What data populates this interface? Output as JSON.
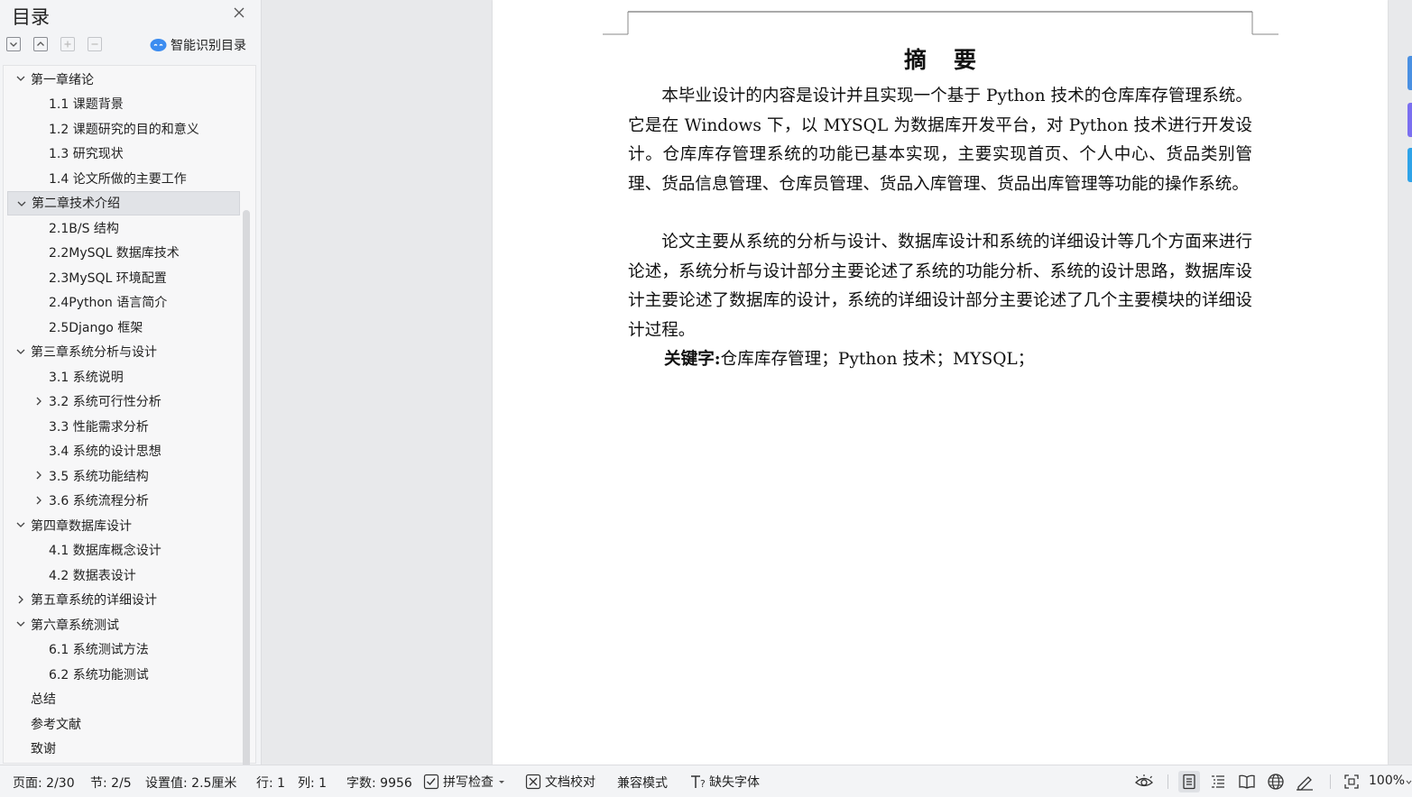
{
  "sidebar": {
    "title": "目录",
    "smart_toc_label": "智能识别目录",
    "toc_items": [
      {
        "label": "第一章绪论",
        "level": 1,
        "caret": "expanded"
      },
      {
        "label": "1.1 课题背景",
        "level": 2,
        "caret": "none"
      },
      {
        "label": "1.2 课题研究的目的和意义",
        "level": 2,
        "caret": "none"
      },
      {
        "label": "1.3  研究现状",
        "level": 2,
        "caret": "none"
      },
      {
        "label": "1.4 论文所做的主要工作",
        "level": 2,
        "caret": "none"
      },
      {
        "label": "第二章技术介绍",
        "level": 1,
        "caret": "expanded",
        "selected": true
      },
      {
        "label": "2.1B/S 结构",
        "level": 2,
        "caret": "none"
      },
      {
        "label": "2.2MySQL 数据库技术",
        "level": 2,
        "caret": "none"
      },
      {
        "label": "2.3MySQL 环境配置",
        "level": 2,
        "caret": "none"
      },
      {
        "label": "2.4Python 语言简介",
        "level": 2,
        "caret": "none"
      },
      {
        "label": "2.5Django 框架",
        "level": 2,
        "caret": "none"
      },
      {
        "label": "第三章系统分析与设计",
        "level": 1,
        "caret": "expanded"
      },
      {
        "label": "3.1 系统说明",
        "level": 2,
        "caret": "none"
      },
      {
        "label": "3.2 系统可行性分析",
        "level": 2,
        "caret": "collapsed"
      },
      {
        "label": "3.3  性能需求分析",
        "level": 2,
        "caret": "none"
      },
      {
        "label": "3.4 系统的设计思想",
        "level": 2,
        "caret": "none"
      },
      {
        "label": "3.5 系统功能结构",
        "level": 2,
        "caret": "collapsed"
      },
      {
        "label": "3.6 系统流程分析",
        "level": 2,
        "caret": "collapsed"
      },
      {
        "label": "第四章数据库设计",
        "level": 1,
        "caret": "expanded"
      },
      {
        "label": "4.1 数据库概念设计",
        "level": 2,
        "caret": "none"
      },
      {
        "label": "4.2 数据表设计",
        "level": 2,
        "caret": "none"
      },
      {
        "label": "第五章系统的详细设计",
        "level": 1,
        "caret": "collapsed"
      },
      {
        "label": "第六章系统测试",
        "level": 1,
        "caret": "expanded"
      },
      {
        "label": "6.1 系统测试方法",
        "level": 2,
        "caret": "none"
      },
      {
        "label": "6.2 系统功能测试",
        "level": 2,
        "caret": "none"
      },
      {
        "label": "总结",
        "level": 1,
        "caret": "none"
      },
      {
        "label": "参考文献",
        "level": 1,
        "caret": "none"
      },
      {
        "label": "致谢",
        "level": 1,
        "caret": "none"
      }
    ]
  },
  "document": {
    "title": "摘要",
    "paragraphs": [
      "本毕业设计的内容是设计并且实现一个基于 Python 技术的仓库库存管理系统。它是在 Windows 下，以 MYSQL 为数据库开发平台，对 Python 技术进行开发设计。仓库库存管理系统的功能已基本实现，主要实现首页、个人中心、货品类别管理、货品信息管理、仓库员管理、货品入库管理、货品出库管理等功能的操作系统。",
      "论文主要从系统的分析与设计、数据库设计和系统的详细设计等几个方面来进行论述，系统分析与设计部分主要论述了系统的功能分析、系统的设计思路，数据库设计主要论述了数据库的设计，系统的详细设计部分主要论述了几个主要模块的详细设计过程。"
    ],
    "keywords_label": "关键字:",
    "keywords": "仓库库存管理；Python 技术；MYSQL；"
  },
  "statusbar": {
    "page": "页面: 2/30",
    "section": "节: 2/5",
    "setting": "设置值: 2.5厘米",
    "row": "行: 1",
    "col": "列: 1",
    "word_count": "字数: 9956",
    "spell_check": "拼写检查",
    "doc_proof": "文档校对",
    "compat_mode": "兼容模式",
    "missing_fonts": "缺失字体",
    "zoom": "100%"
  },
  "colors": {
    "accent_blue": "#3b8cf0",
    "edge_tab_blue": "#4a90e2",
    "edge_tab_purple": "#7b6ff0",
    "edge_tab_cyan": "#2fa3e8"
  }
}
